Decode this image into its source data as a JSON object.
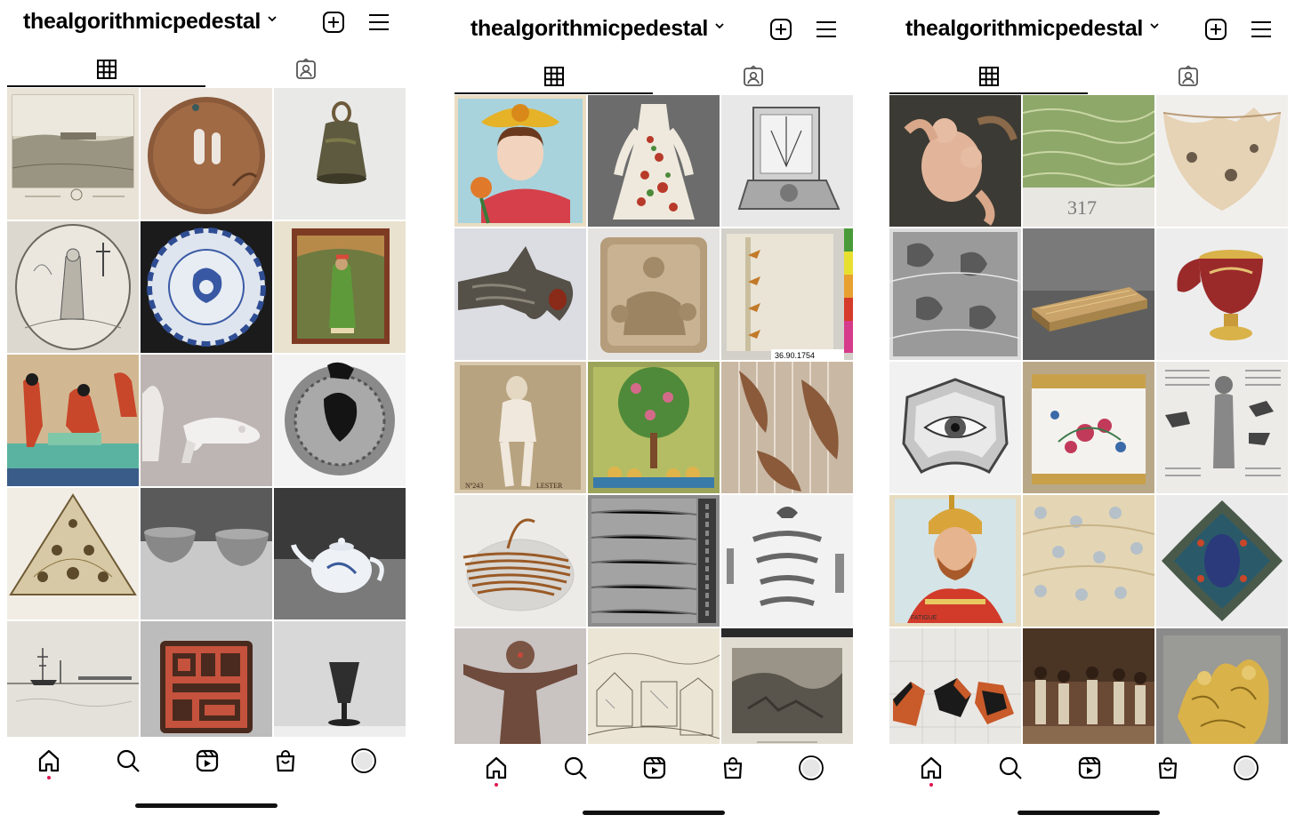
{
  "screens": [
    {
      "username": "thealgorithmicpedestal",
      "tabs": [
        {
          "label": "",
          "icon": "grid-icon",
          "active": true
        },
        {
          "label": "",
          "icon": "tagged-icon",
          "active": false
        }
      ],
      "nav": [
        "home-icon",
        "search-icon",
        "reels-icon",
        "shop-icon",
        "profile-icon"
      ],
      "posts": [
        "landscape-print",
        "bronze-tsuba",
        "bronze-bell",
        "saint-engraving",
        "blue-white-dish",
        "indian-miniature",
        "egyptian-mural",
        "white-shoes",
        "clay-seal",
        "embroidered-textile",
        "grey-bowls",
        "porcelain-teapot",
        "harbor-etching",
        "red-seal",
        "glass-goblet"
      ]
    },
    {
      "username": "thealgorithmicpedestal",
      "tabs": [
        {
          "label": "",
          "icon": "grid-icon",
          "active": true
        },
        {
          "label": "",
          "icon": "tagged-icon",
          "active": false
        }
      ],
      "nav": [
        "home-icon",
        "search-icon",
        "reels-icon",
        "shop-icon",
        "profile-icon"
      ],
      "posts": [
        "flower-woman-card",
        "embroidered-dress",
        "sundial",
        "metal-bird-fibula",
        "stone-relief",
        "fabric-swatch",
        "vintage-photo",
        "tree-painting",
        "leaf-textile",
        "raffia-bundle",
        "stone-texture",
        "ornament-fragments",
        "clay-figure",
        "sketch-drawing",
        "rock-photograph"
      ],
      "labels": {
        "accession": "36.90.1754",
        "photo_caption": "Nº243",
        "photo_caption_2": "LESTER"
      }
    },
    {
      "username": "thealgorithmicpedestal",
      "tabs": [
        {
          "label": "",
          "icon": "grid-icon",
          "active": true
        },
        {
          "label": "",
          "icon": "tagged-icon",
          "active": false
        }
      ],
      "nav": [
        "home-icon",
        "search-icon",
        "reels-icon",
        "shop-icon",
        "profile-icon"
      ],
      "posts": [
        "putti-sculpture",
        "green-textile",
        "broken-pot",
        "lace-pattern",
        "gold-case",
        "enamel-cup",
        "eye-miniature",
        "painted-pot",
        "newspaper-page",
        "soldier-card",
        "floral-fabric",
        "enamel-plaque",
        "pottery-shards",
        "group-photograph",
        "gold-relief"
      ],
      "labels": {
        "number": "317",
        "card_caption": "FATIGUE"
      }
    }
  ],
  "colors": {
    "accent_dot": "#e0144c",
    "text": "#000000",
    "divider": "#dbdbdb"
  }
}
